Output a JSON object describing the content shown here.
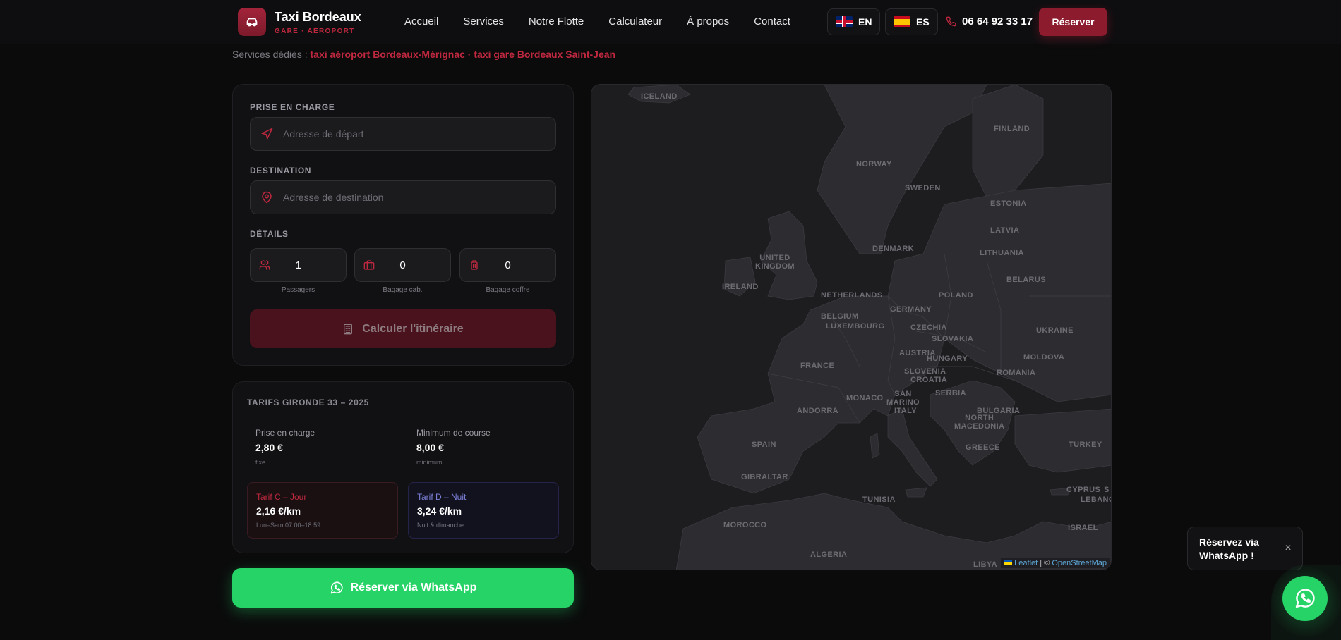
{
  "header": {
    "brand_name": "Taxi Bordeaux",
    "brand_sub": "GARE · AÉROPORT",
    "nav": [
      "Accueil",
      "Services",
      "Notre Flotte",
      "Calculateur",
      "À propos",
      "Contact"
    ],
    "lang_en": "EN",
    "lang_es": "ES",
    "phone": "06 64 92 33 17",
    "reserve_label": "Réserver"
  },
  "services": {
    "prefix": "Services dédiés : ",
    "link1": "taxi aéroport Bordeaux-Mérignac",
    "sep": " · ",
    "link2": "taxi gare Bordeaux Saint-Jean"
  },
  "form": {
    "pickup_label": "PRISE EN CHARGE",
    "pickup_placeholder": "Adresse de départ",
    "dest_label": "DESTINATION",
    "dest_placeholder": "Adresse de destination",
    "details_label": "DÉTAILS",
    "passengers_value": "1",
    "passengers_label": "Passagers",
    "cabin_value": "0",
    "cabin_label": "Bagage cab.",
    "trunk_value": "0",
    "trunk_label": "Bagage coffre",
    "calc_label": "Calculer l'itinéraire"
  },
  "tarifs": {
    "title": "TARIFS GIRONDE 33 – 2025",
    "pickup": {
      "label": "Prise en charge",
      "value": "2,80 €",
      "sub": "fixe"
    },
    "minimum": {
      "label": "Minimum de course",
      "value": "8,00 €",
      "sub": "minimum"
    },
    "day": {
      "label": "Tarif C – Jour",
      "value": "2,16 €/km",
      "sub": "Lun–Sam 07:00–18:59"
    },
    "night": {
      "label": "Tarif D – Nuit",
      "value": "3,24 €/km",
      "sub": "Nuit & dimanche"
    }
  },
  "whatsapp_label": "Réserver via WhatsApp",
  "map": {
    "labels": {
      "iceland": "ICELAND",
      "finland": "FINLAND",
      "norway": "NORWAY",
      "sweden": "SWEDEN",
      "estonia": "ESTONIA",
      "latvia": "LATVIA",
      "lithuania": "LITHUANIA",
      "denmark": "DENMARK",
      "uk": "UNITED\nKINGDOM",
      "ireland": "IRELAND",
      "belarus": "BELARUS",
      "netherlands": "NETHERLANDS",
      "poland": "POLAND",
      "germany": "GERMANY",
      "belgium": "BELGIUM",
      "luxembourg": "LUXEMBOURG",
      "czechia": "CZECHIA",
      "ukraine": "UKRAINE",
      "slovakia": "SLOVAKIA",
      "austria": "AUSTRIA",
      "moldova": "MOLDOVA",
      "hungary": "HUNGARY",
      "france": "FRANCE",
      "slovenia": "SLOVENIA",
      "croatia": "CROATIA",
      "romania": "ROMANIA",
      "serbia": "SERBIA",
      "monaco": "MONACO",
      "san_marino": "SAN\nMARINO",
      "andorra": "ANDORRA",
      "italy": "ITALY",
      "bulgaria": "BULGARIA",
      "north_macedonia": "NORTH\nMACEDONIA",
      "spain": "SPAIN",
      "greece": "GREECE",
      "turkey": "TURKEY",
      "gibraltar": "GIBRALTAR",
      "tunisia": "TUNISIA",
      "cyprus": "CYPRUS",
      "lebanon": "LEBANON",
      "morocco": "MOROCCO",
      "israel": "ISRAEL",
      "algeria": "ALGERIA",
      "libya": "LIBYA",
      "s": "S"
    },
    "attribution_leaflet": "Leaflet",
    "attribution_sep": " | © ",
    "attribution_osm": "OpenStreetMap"
  },
  "toast": {
    "text": "Réservez via WhatsApp !",
    "close": "×"
  },
  "colors": {
    "accent": "#8d1b2e",
    "accent_text": "#c0283f",
    "whatsapp": "#25d366",
    "night": "#7c80d8"
  }
}
